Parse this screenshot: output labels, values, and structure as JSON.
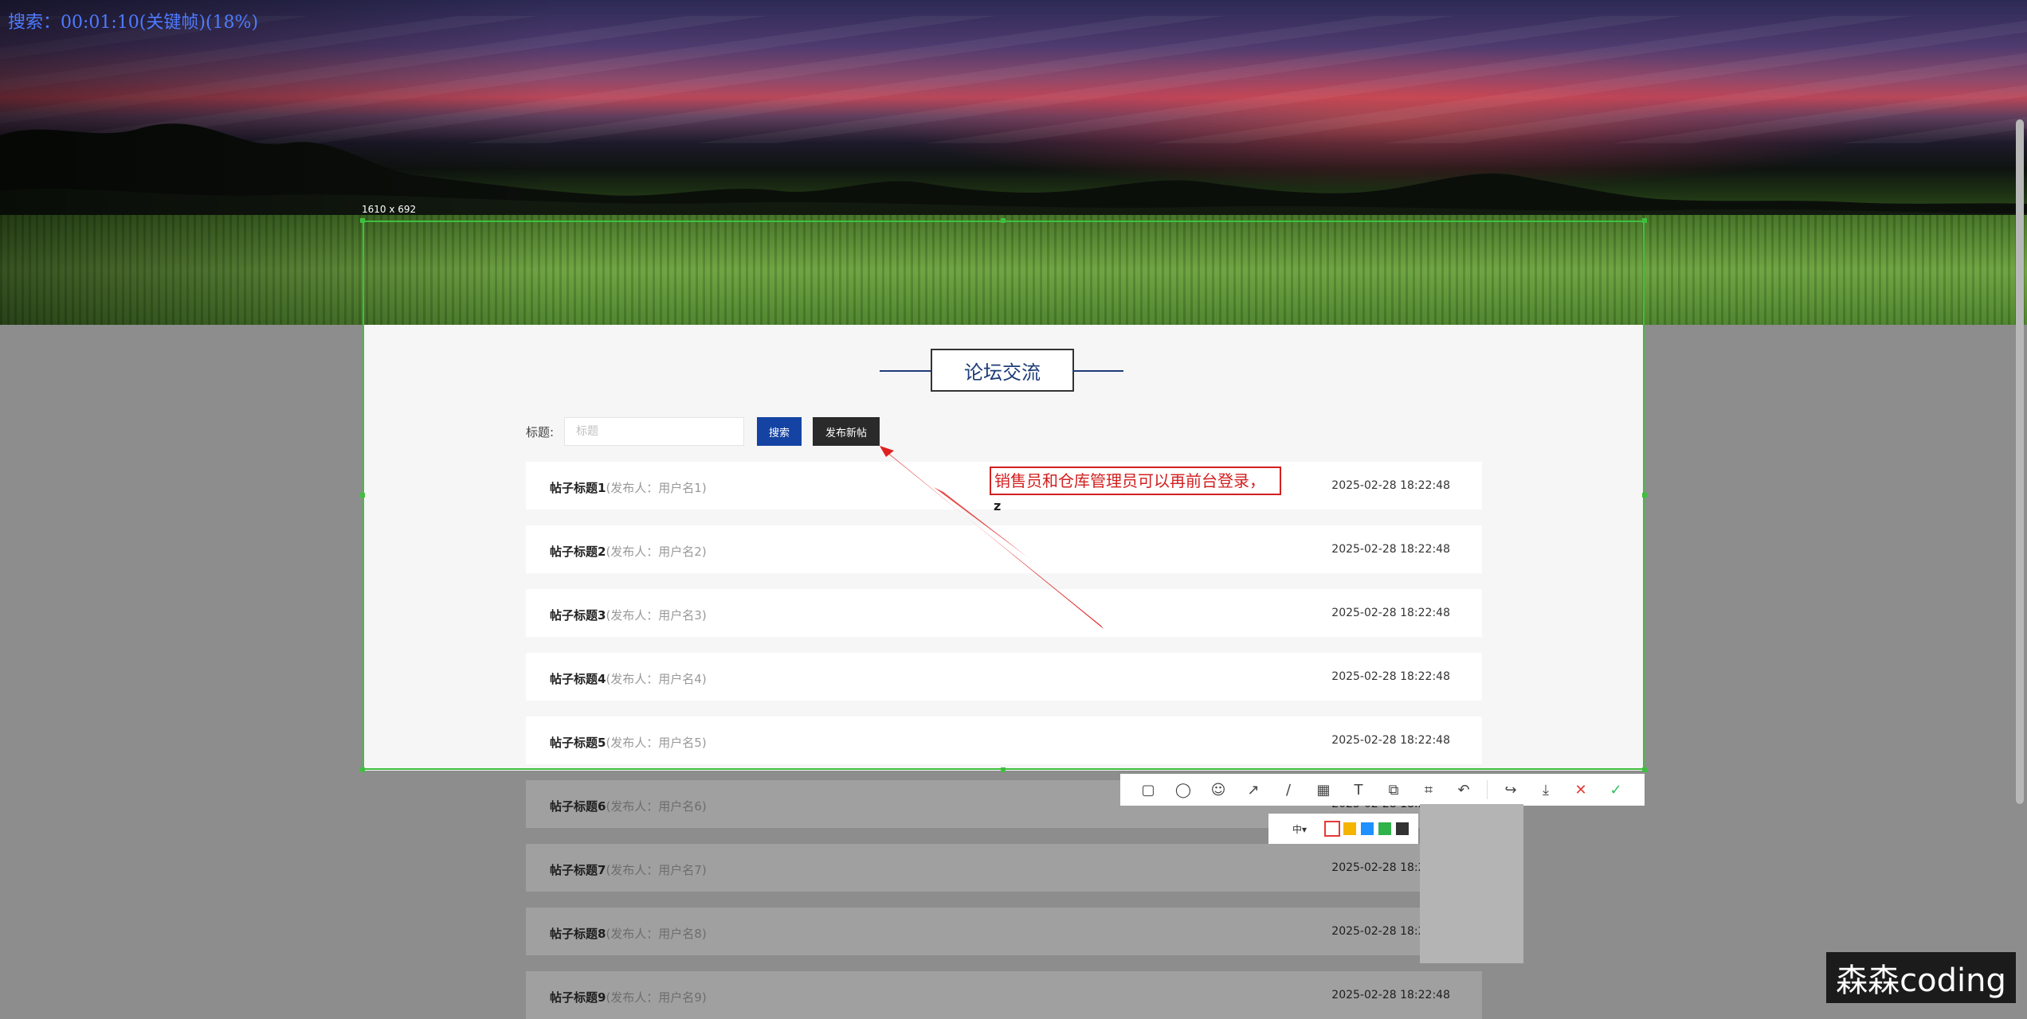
{
  "overlay": {
    "status_text": "搜索：00:01:10(关键帧)(18%)"
  },
  "screenshot_tool": {
    "selection_size": "1610 x 692",
    "annotation_text": "销售员和仓库管理员可以再前台登录，",
    "caret_char": "z",
    "toolbar": [
      {
        "name": "rectangle-tool",
        "glyph": "▢"
      },
      {
        "name": "ellipse-tool",
        "glyph": "◯"
      },
      {
        "name": "emoji-tool",
        "glyph": "☺"
      },
      {
        "name": "arrow-tool",
        "glyph": "↗"
      },
      {
        "name": "line-tool",
        "glyph": "∕"
      },
      {
        "name": "mosaic-tool",
        "glyph": "▦"
      },
      {
        "name": "text-tool",
        "glyph": "T"
      },
      {
        "name": "copy-tool",
        "glyph": "⧉"
      },
      {
        "name": "ocr-tool",
        "glyph": "⌗"
      },
      {
        "name": "undo-tool",
        "glyph": "↶"
      }
    ],
    "toolbar_right": [
      {
        "name": "share-tool",
        "glyph": "↪",
        "style": ""
      },
      {
        "name": "save-tool",
        "glyph": "⤓",
        "style": ""
      },
      {
        "name": "cancel-tool",
        "glyph": "✕",
        "style": "red"
      },
      {
        "name": "confirm-tool",
        "glyph": "✓",
        "style": "green"
      }
    ],
    "size_label": "中▾",
    "colors": [
      "#e53935",
      "#f4b400",
      "#1e90ff",
      "#2fb34a",
      "#333333"
    ]
  },
  "forum": {
    "section_title": "论坛交流",
    "search_label": "标题:",
    "search_placeholder": "标题",
    "search_button": "搜索",
    "new_post_button": "发布新帖",
    "posts": [
      {
        "title": "帖子标题1",
        "author": "(发布人：用户名1)",
        "time": "2025-02-28 18:22:48"
      },
      {
        "title": "帖子标题2",
        "author": "(发布人：用户名2)",
        "time": "2025-02-28 18:22:48"
      },
      {
        "title": "帖子标题3",
        "author": "(发布人：用户名3)",
        "time": "2025-02-28 18:22:48"
      },
      {
        "title": "帖子标题4",
        "author": "(发布人：用户名4)",
        "time": "2025-02-28 18:22:48"
      },
      {
        "title": "帖子标题5",
        "author": "(发布人：用户名5)",
        "time": "2025-02-28 18:22:48"
      },
      {
        "title": "帖子标题6",
        "author": "(发布人：用户名6)",
        "time": "2025-02-28 18:22:48"
      },
      {
        "title": "帖子标题7",
        "author": "(发布人：用户名7)",
        "time": "2025-02-28 18:22:48"
      },
      {
        "title": "帖子标题8",
        "author": "(发布人：用户名8)",
        "time": "2025-02-28 18:22:48"
      },
      {
        "title": "帖子标题9",
        "author": "(发布人：用户名9)",
        "time": "2025-02-28 18:22:48"
      }
    ]
  },
  "watermark": {
    "text": "森森coding"
  }
}
